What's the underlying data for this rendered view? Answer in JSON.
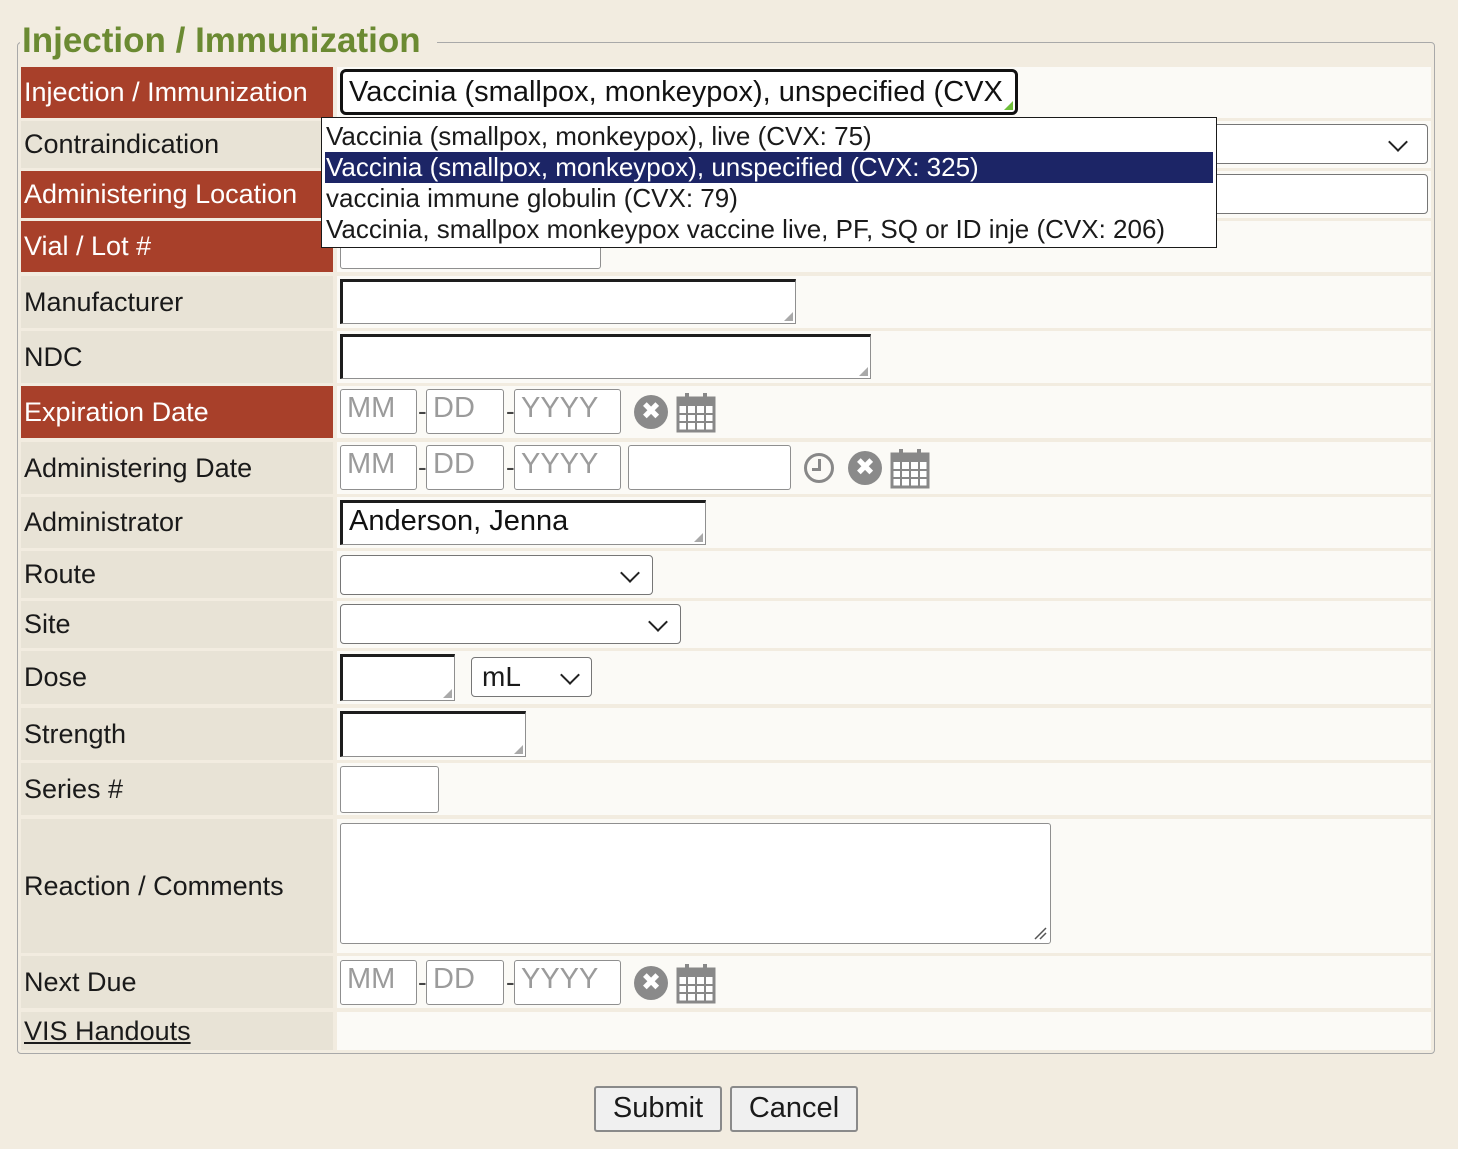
{
  "form": {
    "legend": "Injection / Immunization",
    "labels": {
      "immunization": "Injection / Immunization",
      "contraindication": "Contraindication",
      "location": "Administering Location",
      "lot": "Vial / Lot #",
      "manufacturer": "Manufacturer",
      "ndc": "NDC",
      "expiration": "Expiration Date",
      "admin_date": "Administering Date",
      "administrator": "Administrator",
      "route": "Route",
      "site": "Site",
      "dose": "Dose",
      "strength": "Strength",
      "series": "Series #",
      "reaction": "Reaction / Comments",
      "next_due": "Next Due",
      "vis": "VIS Handouts"
    },
    "immunization_value": "Vaccinia (smallpox, monkeypox), unspecified (CVX",
    "administrator_value": "Anderson, Jenna",
    "dose_unit": "mL",
    "date_placeholders": {
      "mm": "MM",
      "dd": "DD",
      "yyyy": "YYYY"
    },
    "dash": "-",
    "clear_glyph": "✖"
  },
  "dropdown": {
    "options": [
      {
        "label": "Vaccinia (smallpox, monkeypox), live (CVX: 75)",
        "selected": false
      },
      {
        "label": "Vaccinia (smallpox, monkeypox), unspecified (CVX: 325)",
        "selected": true
      },
      {
        "label": "vaccinia immune globulin (CVX: 79)",
        "selected": false
      },
      {
        "label": "Vaccinia, smallpox monkeypox vaccine live, PF, SQ or ID inje (CVX: 206)",
        "selected": false
      }
    ]
  },
  "buttons": {
    "submit": "Submit",
    "cancel": "Cancel"
  },
  "icons": [
    "clear-date-icon",
    "calendar-icon",
    "clock-icon",
    "chevron-down-icon",
    "resize-grip-icon"
  ],
  "colors": {
    "required_label": "#a8402a",
    "legend": "#6b8a32",
    "selected_option": "#1c2566"
  }
}
